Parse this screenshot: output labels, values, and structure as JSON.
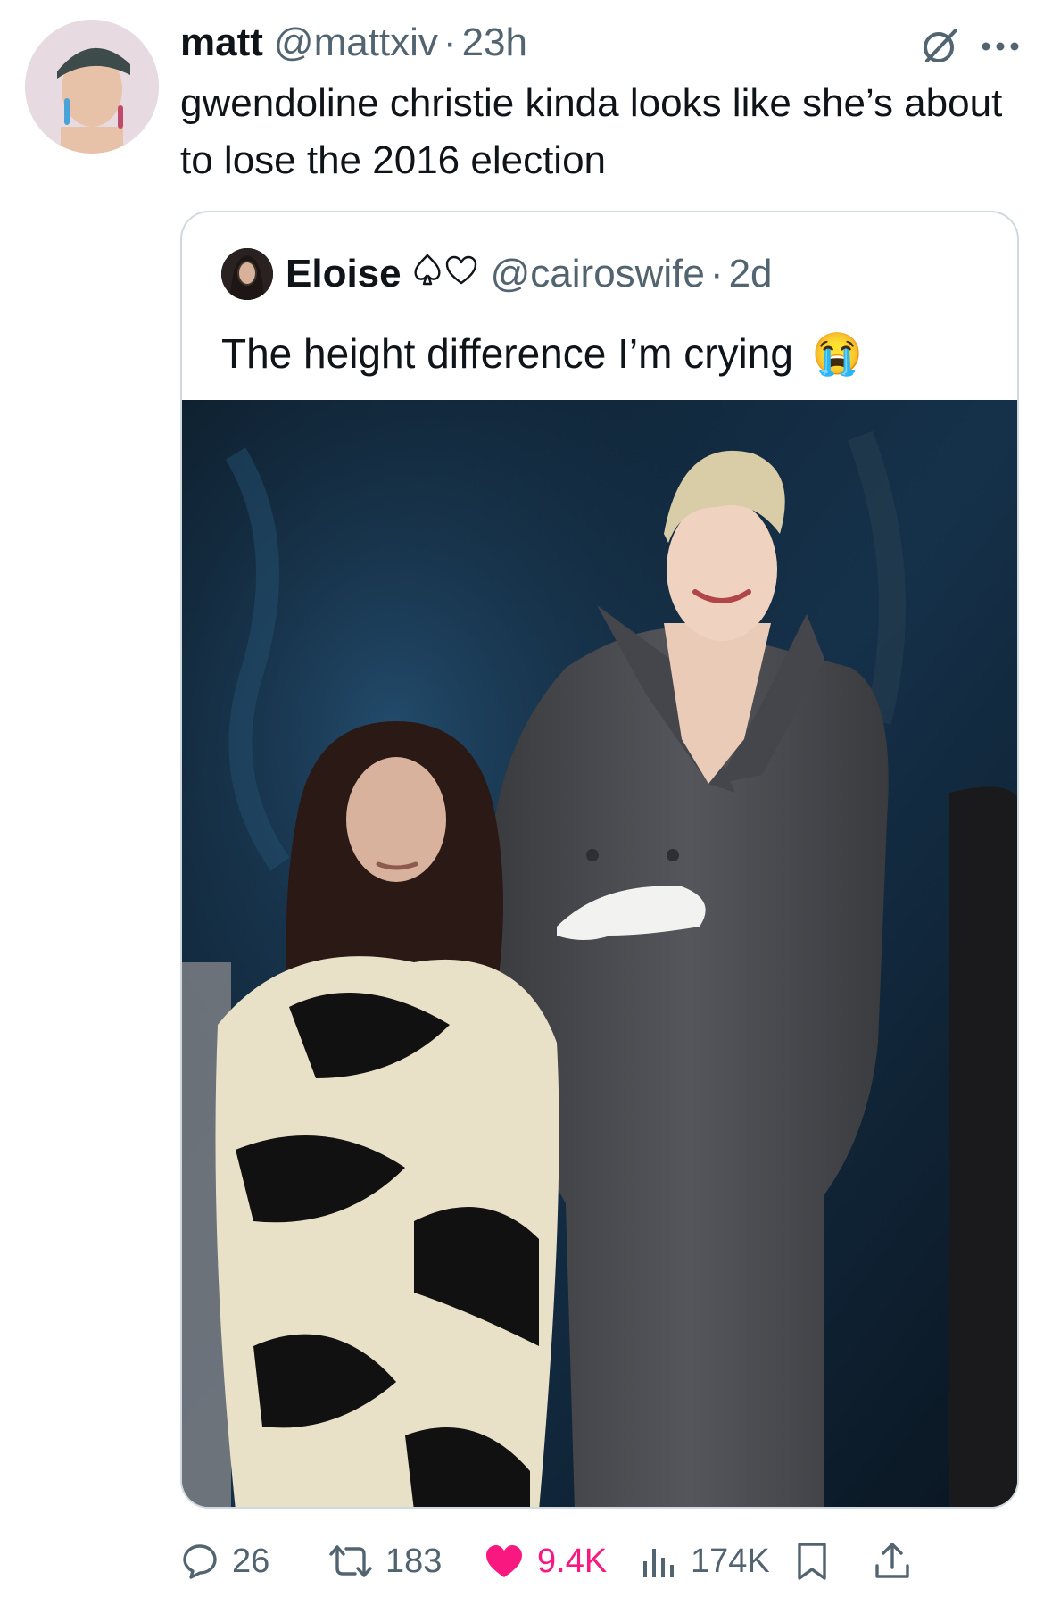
{
  "tweet": {
    "author_name": "matt",
    "author_handle": "@mattxiv",
    "separator": "·",
    "time": "23h",
    "text": "gwendoline christie kinda looks like she’s about to lose the 2016 election"
  },
  "quote": {
    "author_name": "Eloise",
    "author_handle": "@cairoswife",
    "separator": "·",
    "time": "2d",
    "text": "The height difference I’m crying",
    "emoji": "😭"
  },
  "actions": {
    "replies": "26",
    "reposts": "183",
    "likes": "9.4K",
    "views": "174K"
  },
  "colors": {
    "like_pink": "#f91880",
    "secondary_text": "#536471",
    "border": "#cfd9de"
  }
}
